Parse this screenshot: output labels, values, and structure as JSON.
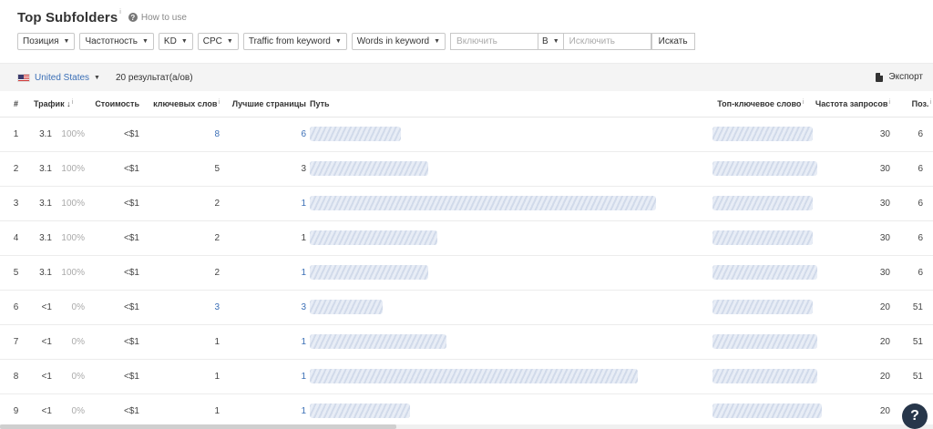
{
  "header": {
    "title": "Top Subfolders",
    "title_info": "i",
    "how_to": "How to use"
  },
  "filters": {
    "position": "Позиция",
    "frequency": "Частотность",
    "kd": "KD",
    "cpc": "CPC",
    "traffic_from_keyword": "Traffic from keyword",
    "words_in_keyword": "Words in keyword",
    "include_placeholder": "Включить",
    "scope": "В",
    "exclude_placeholder": "Исключить",
    "search": "Искать"
  },
  "toolbar": {
    "country": "United States",
    "results": "20 результат(а/ов)",
    "export": "Экспорт"
  },
  "table": {
    "headers": {
      "num": "#",
      "traffic": "Трафик",
      "cost": "Стоимость",
      "keywords": "ключевых слов",
      "best_pages": "Лучшие страницы",
      "path": "Путь",
      "top_keyword": "Топ-ключевое слово",
      "volume": "Частота запросов",
      "position": "Поз."
    },
    "rows": [
      {
        "num": "1",
        "traffic": "3.1",
        "share": "100%",
        "cost": "<$1",
        "keywords": "8",
        "pages": "6",
        "volume": "30",
        "pos": "6"
      },
      {
        "num": "2",
        "traffic": "3.1",
        "share": "100%",
        "cost": "<$1",
        "keywords": "5",
        "pages": "3",
        "volume": "30",
        "pos": "6"
      },
      {
        "num": "3",
        "traffic": "3.1",
        "share": "100%",
        "cost": "<$1",
        "keywords": "2",
        "pages": "1",
        "volume": "30",
        "pos": "6"
      },
      {
        "num": "4",
        "traffic": "3.1",
        "share": "100%",
        "cost": "<$1",
        "keywords": "2",
        "pages": "1",
        "volume": "30",
        "pos": "6"
      },
      {
        "num": "5",
        "traffic": "3.1",
        "share": "100%",
        "cost": "<$1",
        "keywords": "2",
        "pages": "1",
        "volume": "30",
        "pos": "6"
      },
      {
        "num": "6",
        "traffic": "<1",
        "share": "0%",
        "cost": "<$1",
        "keywords": "3",
        "pages": "3",
        "volume": "20",
        "pos": "51"
      },
      {
        "num": "7",
        "traffic": "<1",
        "share": "0%",
        "cost": "<$1",
        "keywords": "1",
        "pages": "1",
        "volume": "20",
        "pos": "51"
      },
      {
        "num": "8",
        "traffic": "<1",
        "share": "0%",
        "cost": "<$1",
        "keywords": "1",
        "pages": "1",
        "volume": "20",
        "pos": "51"
      },
      {
        "num": "9",
        "traffic": "<1",
        "share": "0%",
        "cost": "<$1",
        "keywords": "1",
        "pages": "1",
        "volume": "20",
        "pos": "51"
      }
    ]
  },
  "help": "?",
  "colors": {
    "link": "#3b6fb6",
    "muted": "#aaaaaa",
    "toolbar_bg": "#f4f4f4",
    "help_bg": "#27364a"
  }
}
